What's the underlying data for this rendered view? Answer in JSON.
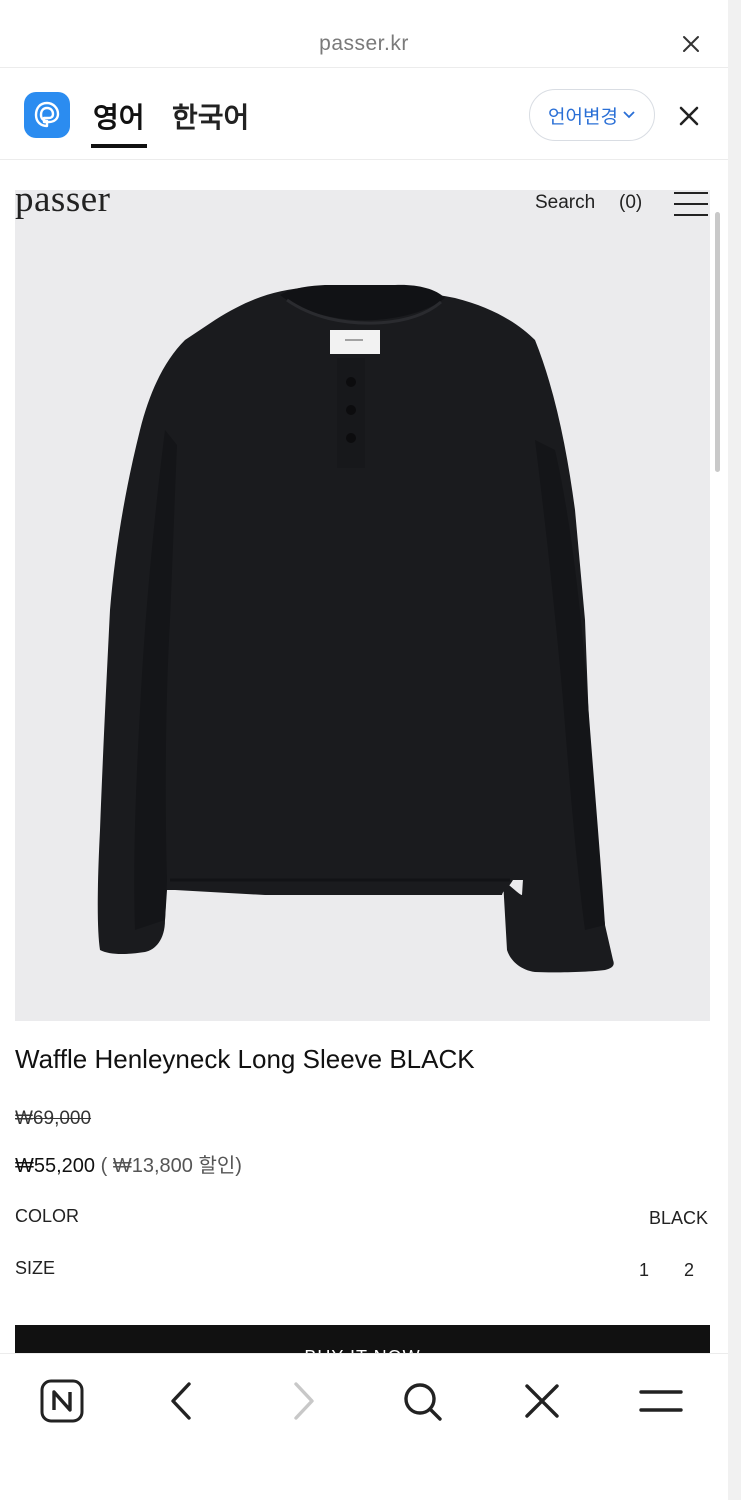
{
  "browser": {
    "url": "passer.kr"
  },
  "translate_bar": {
    "tab_english": "영어",
    "tab_korean": "한국어",
    "change_language": "언어변경"
  },
  "site": {
    "logo": "passer",
    "search": "Search",
    "cart_count": "(0)"
  },
  "product": {
    "title": "Waffle Henleyneck Long Sleeve BLACK",
    "original_price": "₩69,000",
    "sale_price": "₩55,200",
    "discount": "( ₩13,800 할인)",
    "color_label": "COLOR",
    "color_value": "BLACK",
    "size_label": "SIZE",
    "sizes": [
      "1",
      "2"
    ],
    "buy_button": "BUY IT NOW"
  },
  "colors": {
    "papago_blue": "#2b8cf0",
    "lang_change_text": "#2a6fd6",
    "garment": "#1a1b1e"
  },
  "icons": {
    "url_close": "close-icon",
    "papago": "papago-icon",
    "menu": "hamburger-icon",
    "toolbar": [
      "naver-n-icon",
      "back-arrow-icon",
      "forward-arrow-icon",
      "search-icon",
      "close-icon",
      "menu-icon"
    ]
  }
}
